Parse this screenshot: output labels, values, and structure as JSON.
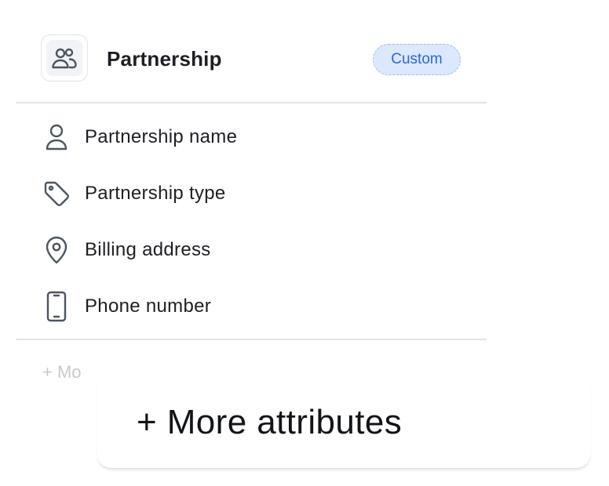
{
  "object": {
    "title": "Partnership",
    "badge": "Custom",
    "icon": "users-icon"
  },
  "attributes": [
    {
      "label": "Partnership name",
      "icon": "person-icon"
    },
    {
      "label": "Partnership type",
      "icon": "tag-icon"
    },
    {
      "label": "Billing address",
      "icon": "map-pin-icon"
    },
    {
      "label": "Phone number",
      "icon": "phone-icon"
    }
  ],
  "footer": {
    "faded_label": "+ Mo"
  },
  "popover": {
    "label": "+ More attributes"
  },
  "colors": {
    "badge_bg": "#dbe8fd",
    "badge_text": "#2e66d6",
    "icon_stroke": "#4b5563",
    "divider": "#e2e4e9"
  }
}
